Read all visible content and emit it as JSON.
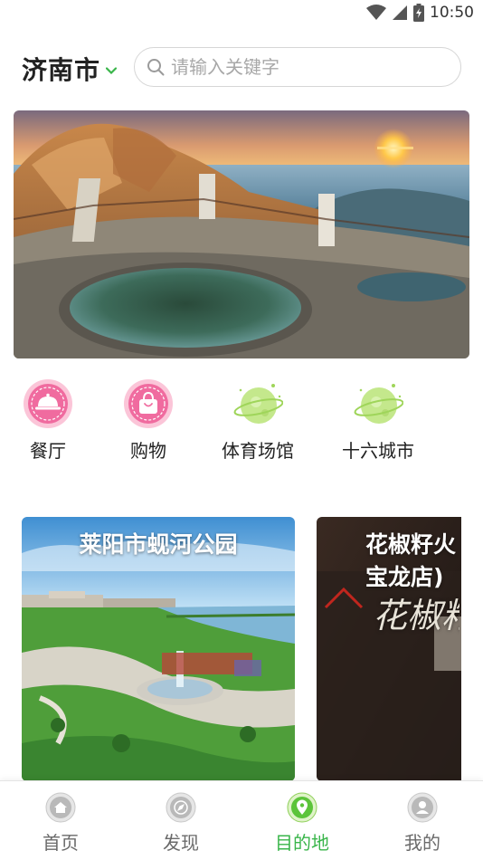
{
  "status": {
    "time": "10:50"
  },
  "header": {
    "city": "济南市",
    "search_placeholder": "请输入关键字"
  },
  "banner": {
    "image": "mountain-summit-pools-sunset"
  },
  "categories": [
    {
      "label": "餐厅",
      "icon": "restaurant-cloche-icon",
      "color": "#f06b9f"
    },
    {
      "label": "购物",
      "icon": "shopping-bag-icon",
      "color": "#f06b9f"
    },
    {
      "label": "体育场馆",
      "icon": "planet-icon",
      "color": "#9fd55a"
    },
    {
      "label": "十六城市",
      "icon": "planet-icon",
      "color": "#9fd55a"
    }
  ],
  "cards": [
    {
      "title": "莱阳市蚬河公园"
    },
    {
      "title_line1": "花椒籽火",
      "title_line2": "宝龙店)",
      "sign_text": "花椒籽"
    }
  ],
  "tabbar": {
    "active": "目的地",
    "accent": "#39b54a",
    "tabs": [
      {
        "label": "首页",
        "icon": "home-icon"
      },
      {
        "label": "发现",
        "icon": "compass-icon"
      },
      {
        "label": "目的地",
        "icon": "location-pin-icon"
      },
      {
        "label": "我的",
        "icon": "user-icon"
      }
    ]
  }
}
